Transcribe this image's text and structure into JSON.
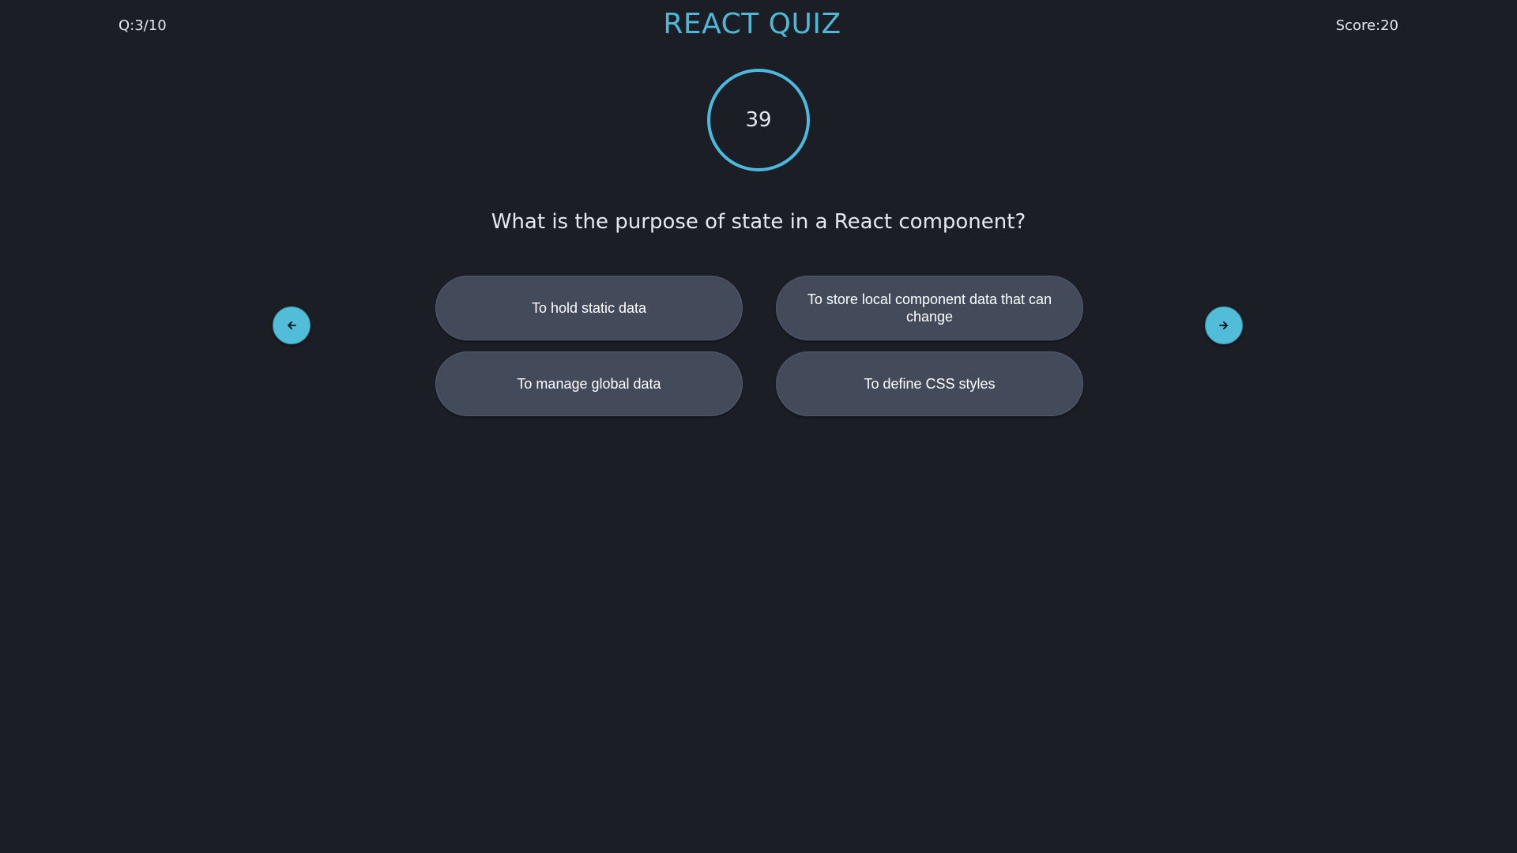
{
  "header": {
    "question_counter": "Q:3/10",
    "title": "REACT QUIZ",
    "score": "Score:20"
  },
  "timer": {
    "value": "39"
  },
  "question": {
    "text": "What is the purpose of state in a React component?"
  },
  "options": [
    {
      "label": "To hold static data"
    },
    {
      "label": "To store local component data that can change"
    },
    {
      "label": "To manage global data"
    },
    {
      "label": "To define CSS styles"
    }
  ],
  "navigation": {
    "prev_icon": "arrow-left-icon",
    "next_icon": "arrow-right-icon"
  },
  "colors": {
    "background": "#1b1e25",
    "accent": "#4fb8d6",
    "option_background": "#434a59",
    "text": "#e6e8ec"
  }
}
